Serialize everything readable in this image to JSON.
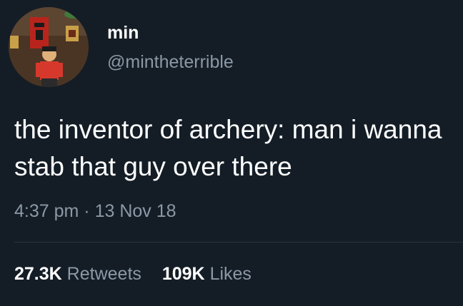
{
  "tweet": {
    "author": {
      "name": "min",
      "handle": "@mintheterrible"
    },
    "text": "the inventor of archery: man i wanna stab that guy over there",
    "time": "4:37 pm",
    "separator": "·",
    "date": "13 Nov 18",
    "stats": {
      "retweets": {
        "count": "27.3K",
        "label": "Retweets"
      },
      "likes": {
        "count": "109K",
        "label": "Likes"
      }
    }
  },
  "colors": {
    "background": "#141d26",
    "primary_text": "#ffffff",
    "secondary_text": "#8b98a5",
    "divider": "#263340"
  }
}
